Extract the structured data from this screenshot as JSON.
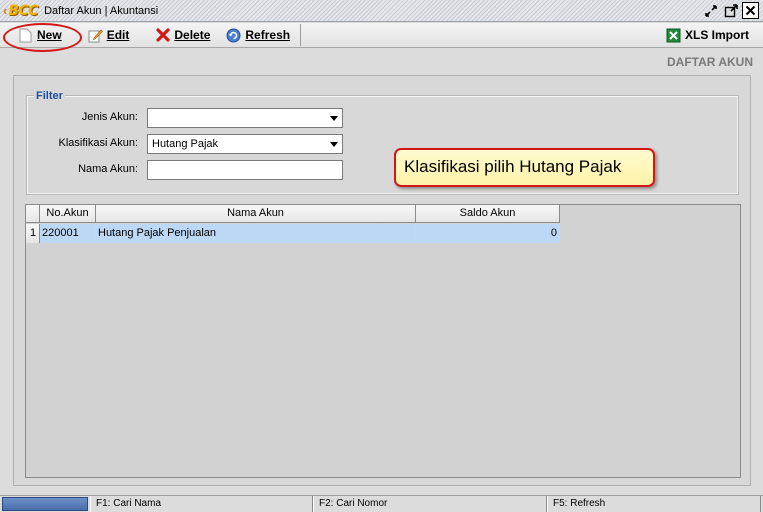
{
  "window": {
    "brand": "BCC",
    "title": "Daftar Akun | Akuntansi",
    "buttons": [
      "restore-icon",
      "maximize-icon",
      "close-icon"
    ]
  },
  "toolbar": {
    "new_label": "New",
    "edit_label": "Edit",
    "delete_label": "Delete",
    "refresh_label": "Refresh",
    "xls_label": "XLS Import"
  },
  "page": {
    "heading": "DAFTAR AKUN"
  },
  "filter": {
    "legend": "Filter",
    "jenis_label": "Jenis Akun:",
    "jenis_value": "",
    "klasifikasi_label": "Klasifikasi Akun:",
    "klasifikasi_value": "Hutang Pajak",
    "nama_label": "Nama Akun:",
    "nama_value": ""
  },
  "callout": {
    "text": "Klasifikasi pilih Hutang Pajak"
  },
  "grid": {
    "columns": [
      "No.Akun",
      "Nama Akun",
      "Saldo Akun"
    ],
    "rows": [
      {
        "num": "1",
        "no_akun": "220001",
        "nama_akun": "Hutang Pajak Penjualan",
        "saldo": "0"
      }
    ]
  },
  "statusbar": {
    "f1": "F1: Cari Nama",
    "f2": "F2: Cari Nomor",
    "f5": "F5: Refresh"
  },
  "colors": {
    "accent_red": "#d01818",
    "legend_blue": "#1e4fa0",
    "selection": "#bcd8f4"
  }
}
